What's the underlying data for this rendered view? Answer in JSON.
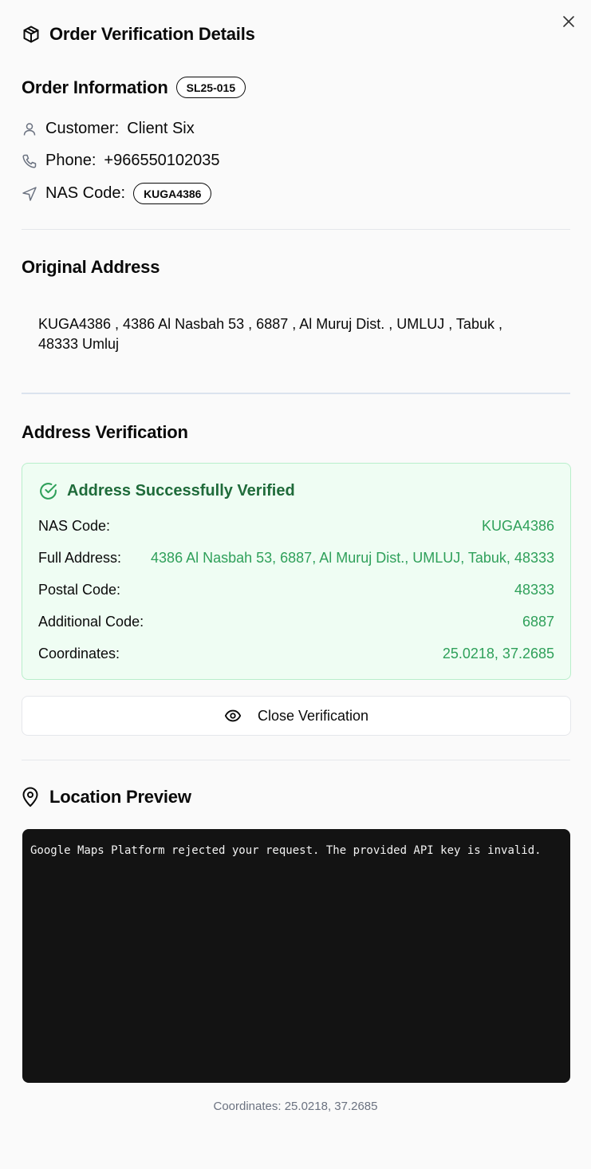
{
  "dialog": {
    "title": "Order Verification Details",
    "close_icon": "x-icon"
  },
  "order": {
    "section_title": "Order Information",
    "order_id": "SL25-015",
    "customer_label": "Customer:",
    "customer_value": "Client Six",
    "phone_label": "Phone:",
    "phone_value": "+966550102035",
    "nas_label": "NAS Code:",
    "nas_value": "KUGA4386"
  },
  "original_address": {
    "section_title": "Original Address",
    "text": "KUGA4386 , 4386 Al Nasbah 53 , 6887 , Al Muruj Dist. , UMLUJ , Tabuk , 48333 Umluj"
  },
  "verification": {
    "section_title": "Address Verification",
    "status": "Address Successfully Verified",
    "rows": [
      {
        "label": "NAS Code:",
        "value": "KUGA4386"
      },
      {
        "label": "Full Address:",
        "value": "4386 Al Nasbah 53, 6887, Al Muruj Dist., UMLUJ, Tabuk, 48333"
      },
      {
        "label": "Postal Code:",
        "value": "48333"
      },
      {
        "label": "Additional Code:",
        "value": "6887"
      },
      {
        "label": "Coordinates:",
        "value": "25.0218, 37.2685"
      }
    ],
    "close_button_label": "Close Verification"
  },
  "location": {
    "section_title": "Location Preview",
    "map_error": "Google Maps Platform rejected your request. The provided API key is invalid.",
    "coordinates_caption": "Coordinates: 25.0218, 37.2685"
  },
  "colors": {
    "success_text": "#1f6b3a",
    "success_value": "#2fa05a",
    "success_bg": "#effdf3",
    "map_bg": "#131313"
  }
}
